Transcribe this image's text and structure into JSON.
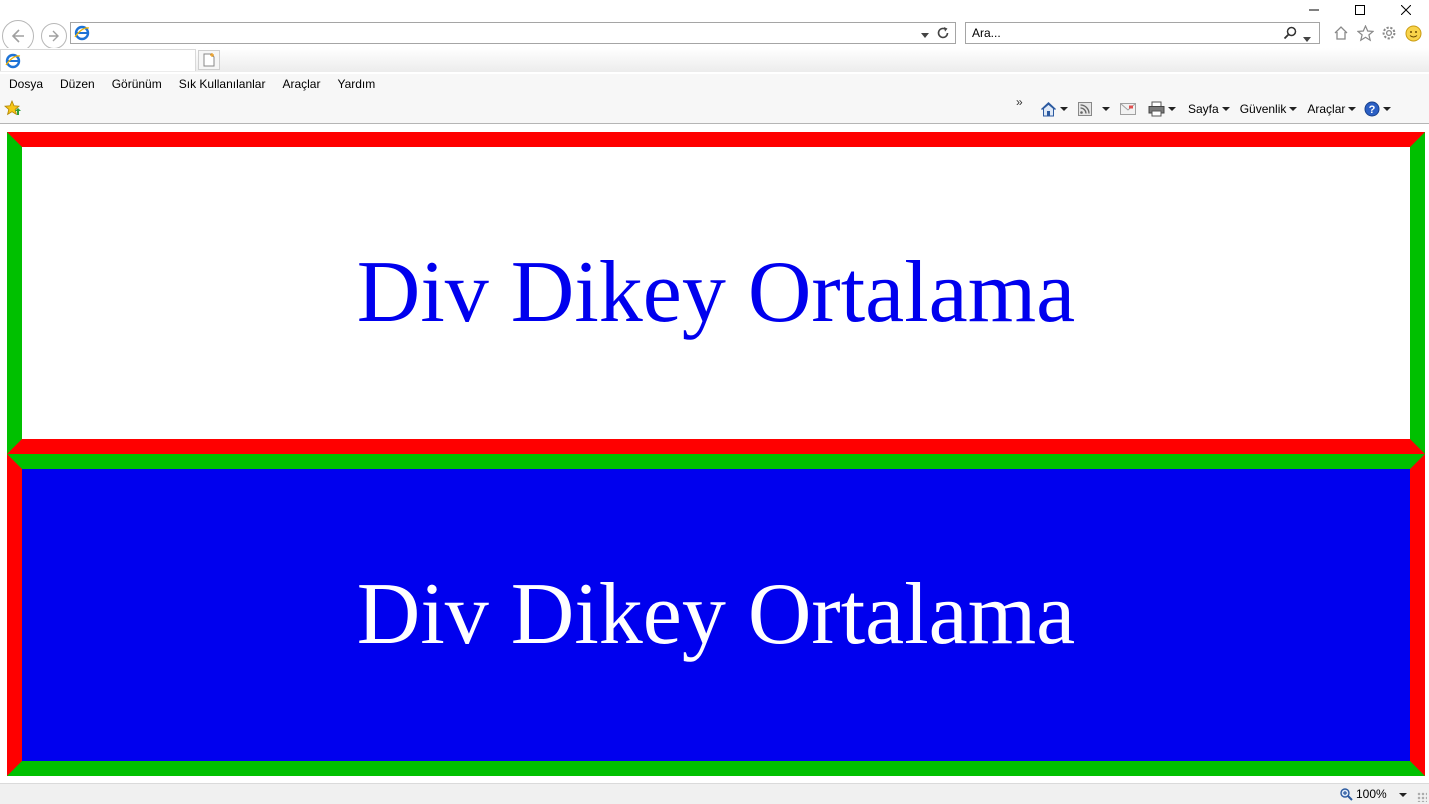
{
  "window": {
    "controls": {
      "minimize_icon": "minimize-icon",
      "maximize_icon": "maximize-icon",
      "close_icon": "close-icon"
    }
  },
  "navigation": {
    "back_icon": "back-arrow-icon",
    "forward_icon": "forward-arrow-icon",
    "address": {
      "value": "",
      "placeholder": ""
    },
    "search": {
      "placeholder": "Ara..."
    }
  },
  "tabs": [
    {
      "label": "",
      "active": true
    }
  ],
  "menu": {
    "items": [
      {
        "id": "file",
        "label": "Dosya"
      },
      {
        "id": "edit",
        "label": "Düzen"
      },
      {
        "id": "view",
        "label": "Görünüm"
      },
      {
        "id": "favorites",
        "label": "Sık Kullanılanlar"
      },
      {
        "id": "tools",
        "label": "Araçlar"
      },
      {
        "id": "help",
        "label": "Yardım"
      }
    ]
  },
  "command_bar": {
    "page_label": "Sayfa",
    "safety_label": "Güvenlik",
    "tools_label": "Araçlar",
    "more_chevron": "»"
  },
  "content": {
    "box1": {
      "text": "Div Dikey Ortalama",
      "background": "#ffffff",
      "text_color": "#0000ee",
      "border_top_bottom": "#ff0000",
      "border_left_right": "#00c000"
    },
    "box2": {
      "text": "Div Dikey Ortalama",
      "background": "#0000ee",
      "text_color": "#ffffff",
      "border_top_bottom": "#00c000",
      "border_left_right": "#ff0000"
    }
  },
  "status_bar": {
    "zoom": "100%"
  }
}
